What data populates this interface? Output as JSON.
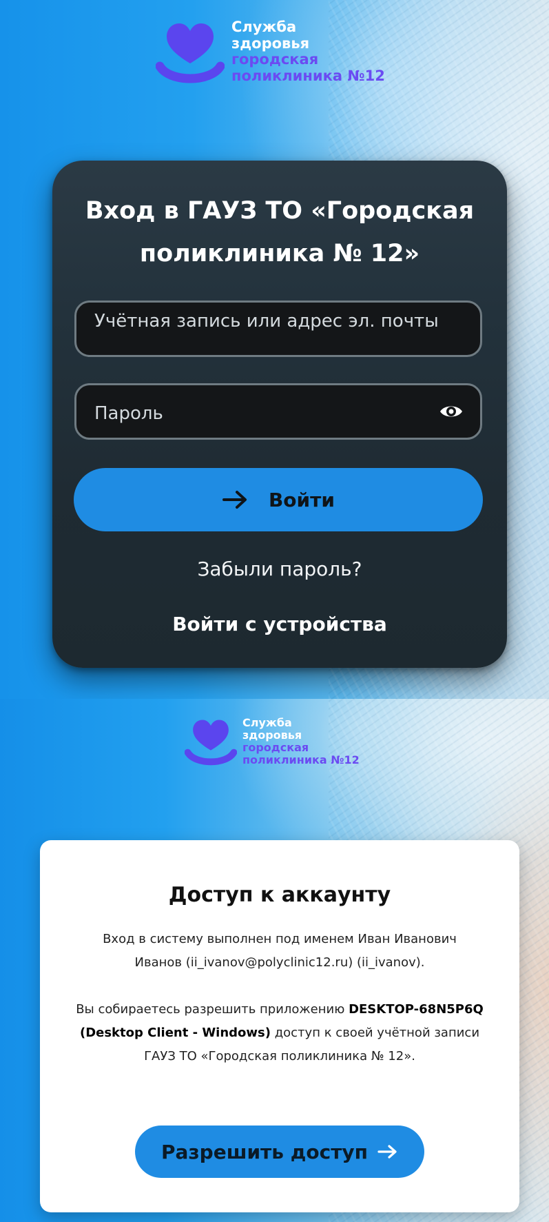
{
  "brand": {
    "line1": "Служба",
    "line2": "здоровья",
    "line3": "городская",
    "line4": "поликлиника №12"
  },
  "login": {
    "title_line1": "Вход в ГАУЗ ТО «Городская",
    "title_line2": "поликлиника № 12»",
    "username_placeholder": "Учётная запись или адрес эл. почты",
    "password_placeholder": "Пароль",
    "submit_label": "Войти",
    "forgot_label": "Забыли пароль?",
    "device_login_label": "Войти с устройства"
  },
  "consent": {
    "title": "Доступ к аккаунту",
    "p1_line1": "Вход в систему выполнен под именем Иван Иванович",
    "p1_line2": "Иванов (ii_ivanov@polyclinic12.ru) (ii_ivanov).",
    "p2_a": "Вы собираетесь разрешить приложению ",
    "p2_app_name": "DESKTOP-68N5P6Q",
    "p2_app_client": "(Desktop Client - Windows)",
    "p2_b": " доступ к своей учётной записи",
    "p2_line3": "ГАУЗ ТО «Городская поликлиника № 12».",
    "allow_label": "Разрешить доступ"
  },
  "colors": {
    "accent_blue": "#1f8ce3",
    "card_dark": "#23323c",
    "logo_purple": "#6b4bf2"
  },
  "icons": [
    "heart-smile-logo-icon",
    "eye-icon",
    "arrow-right-icon"
  ]
}
